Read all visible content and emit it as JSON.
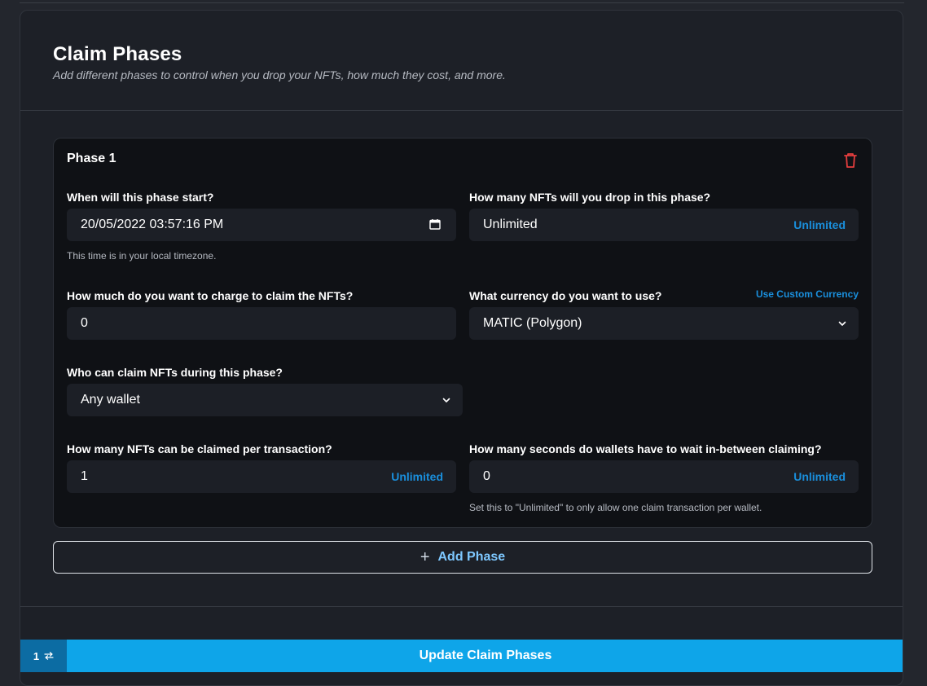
{
  "header": {
    "title": "Claim Phases",
    "subtitle": "Add different phases to control when you drop your NFTs, how much they cost, and more."
  },
  "phase": {
    "title": "Phase 1",
    "start": {
      "label": "When will this phase start?",
      "value": "20/05/2022 03:57:16 PM",
      "helper": "This time is in your local timezone."
    },
    "drop_count": {
      "label": "How many NFTs will you drop in this phase?",
      "value": "Unlimited",
      "link": "Unlimited"
    },
    "price": {
      "label": "How much do you want to charge to claim the NFTs?",
      "value": "0"
    },
    "currency": {
      "label": "What currency do you want to use?",
      "custom_link": "Use Custom Currency",
      "value": "MATIC (Polygon)"
    },
    "who_can_claim": {
      "label": "Who can claim NFTs during this phase?",
      "value": "Any wallet"
    },
    "per_transaction": {
      "label": "How many NFTs can be claimed per transaction?",
      "value": "1",
      "link": "Unlimited"
    },
    "wait_seconds": {
      "label": "How many seconds do wallets have to wait in-between claiming?",
      "value": "0",
      "link": "Unlimited",
      "helper": "Set this to \"Unlimited\" to only allow one claim transaction per wallet."
    }
  },
  "add_phase": {
    "label": "Add Phase"
  },
  "footer": {
    "tx_count": "1",
    "update_label": "Update Claim Phases"
  },
  "colors": {
    "accent": "#0ea5e9",
    "link": "#1a8fdc",
    "danger": "#e53e3e",
    "panel": "#0f1115",
    "field": "#1c1f26"
  }
}
